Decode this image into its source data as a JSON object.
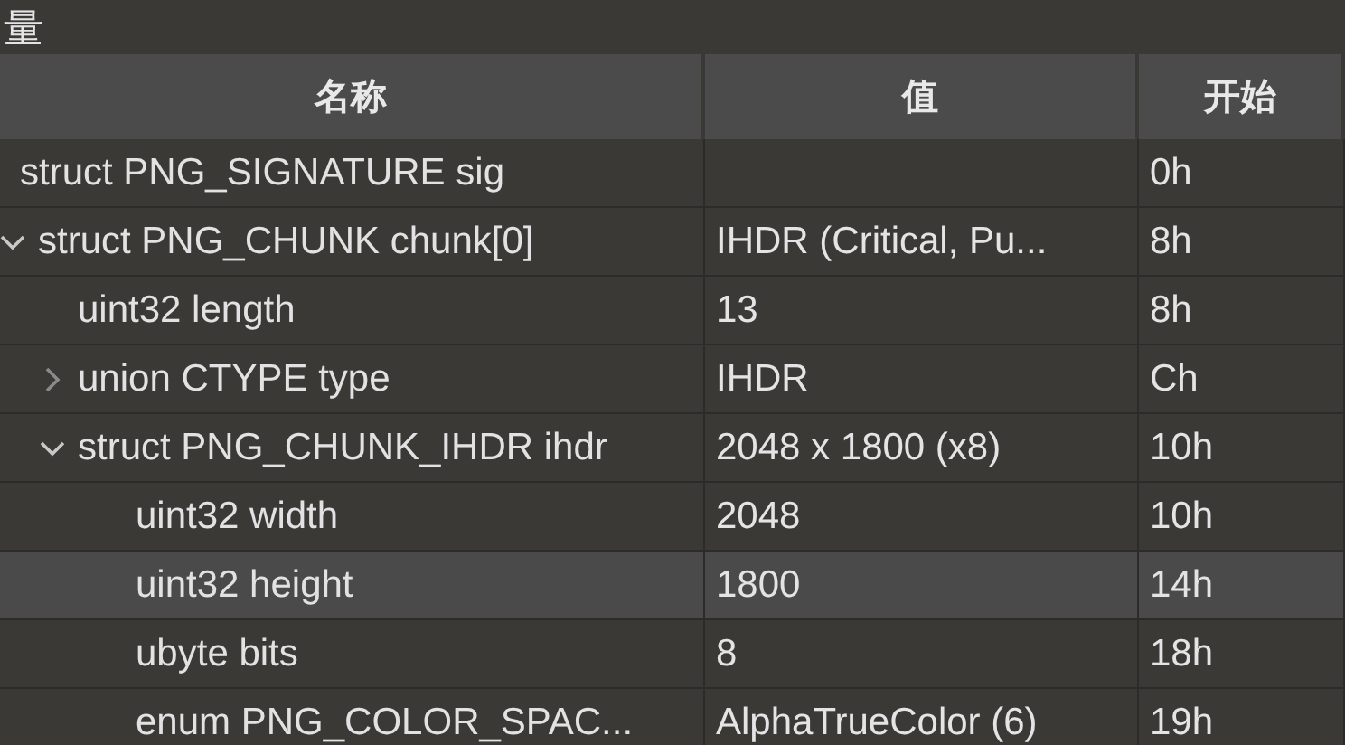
{
  "panel": {
    "title": "量"
  },
  "table": {
    "columns": [
      "名称",
      "值",
      "开始"
    ],
    "rows": [
      {
        "name": "struct PNG_SIGNATURE sig",
        "start": "0h",
        "selected": false
      },
      {
        "name": "struct PNG_CHUNK chunk[0]",
        "value": "IHDR  (Critical, Pu...",
        "start": "8h",
        "selected": false,
        "expanded": true,
        "children": [
          {
            "name": "uint32 length",
            "value": "13",
            "start": "8h",
            "selected": false
          },
          {
            "name": "union CTYPE type",
            "value": "IHDR",
            "start": "Ch",
            "selected": false,
            "expanded": false
          },
          {
            "name": "struct PNG_CHUNK_IHDR ihdr",
            "value": "2048 x 1800 (x8)",
            "start": "10h",
            "selected": false,
            "expanded": true,
            "children": [
              {
                "name": "uint32 width",
                "value": "2048",
                "start": "10h",
                "selected": false
              },
              {
                "name": "uint32 height",
                "value": "1800",
                "start": "14h",
                "selected": true
              },
              {
                "name": "ubyte bits",
                "value": "8",
                "start": "18h",
                "selected": false
              },
              {
                "name": "enum PNG_COLOR_SPAC...",
                "value": "AlphaTrueColor (6)",
                "start": "19h",
                "selected": false
              }
            ]
          }
        ]
      }
    ]
  }
}
